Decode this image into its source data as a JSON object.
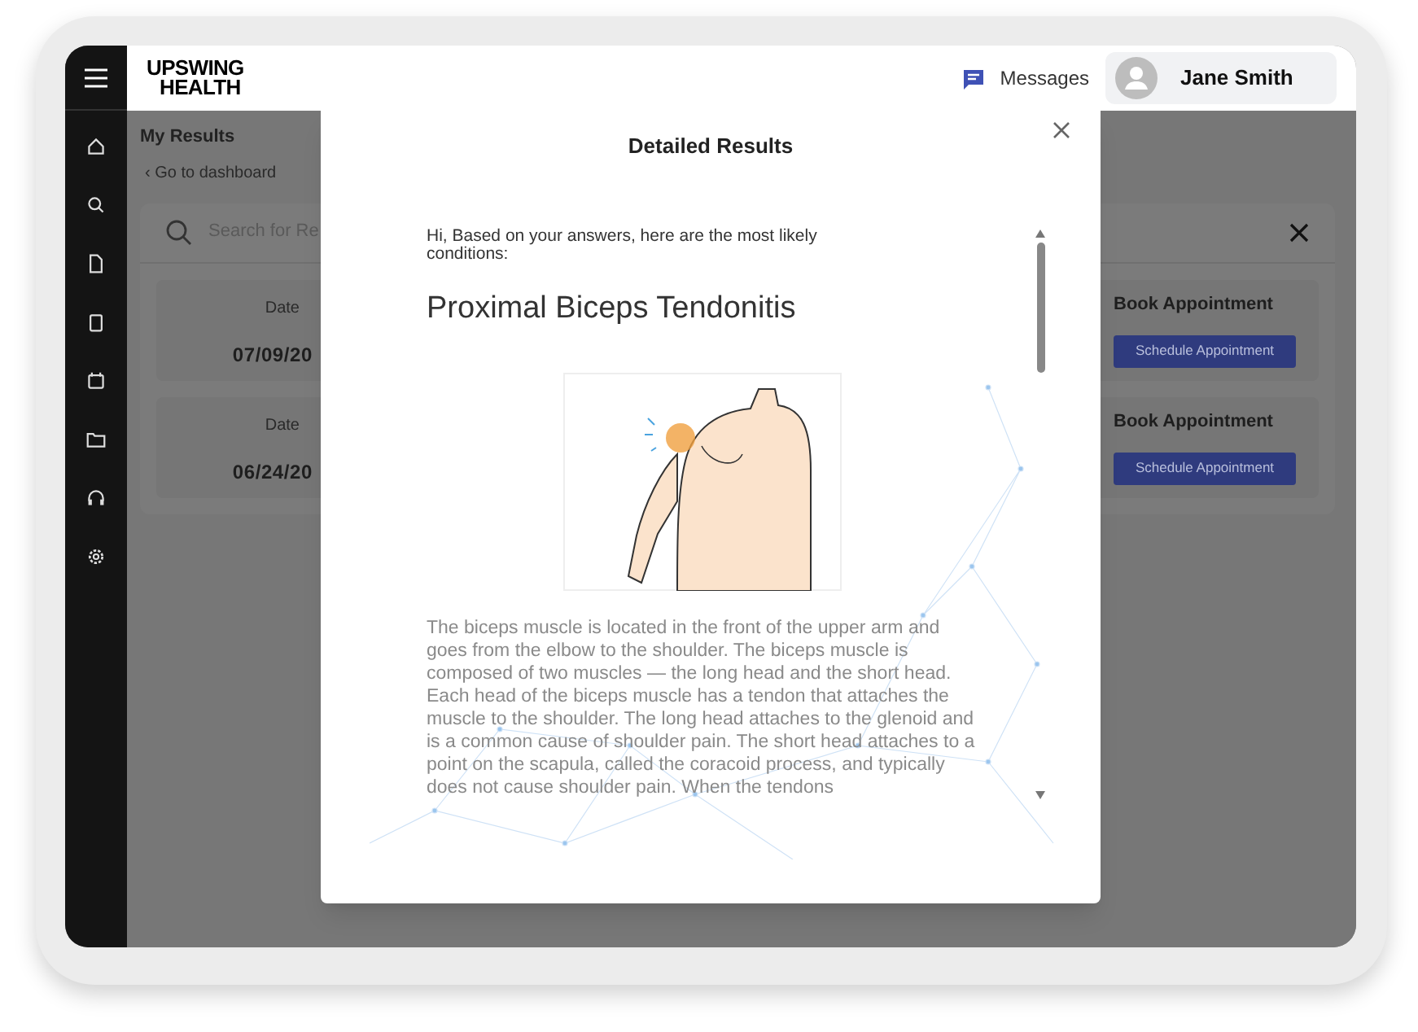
{
  "header": {
    "logo": {
      "line1": "UPSWING",
      "line2": "HEALTH"
    },
    "messages": "Messages",
    "user": "Jane Smith"
  },
  "page": {
    "title": "My Results",
    "back_link": "‹ Go to dashboard"
  },
  "search": {
    "placeholder": "Search for Re"
  },
  "results": [
    {
      "date_label": "Date",
      "date": "07/09/20",
      "action_title": "Book Appointment",
      "action_button": "Schedule Appointment"
    },
    {
      "date_label": "Date",
      "date": "06/24/20",
      "action_title": "Book Appointment",
      "action_button": "Schedule Appointment"
    }
  ],
  "modal": {
    "title": "Detailed Results",
    "intro": "Hi, Based on your answers, here are the most likely conditions:",
    "condition": "Proximal Biceps Tendonitis",
    "description": "The biceps muscle is located in the front of the upper arm and goes from the elbow to the shoulder. The biceps muscle is composed of two muscles — the long head and the short head. Each head of the biceps muscle has a tendon that attaches the muscle to the shoulder. The long head attaches to the glenoid and is a common cause of shoulder pain. The short head attaches to a point on the scapula, called the coracoid process, and typically does not cause shoulder pain. When the tendons"
  }
}
